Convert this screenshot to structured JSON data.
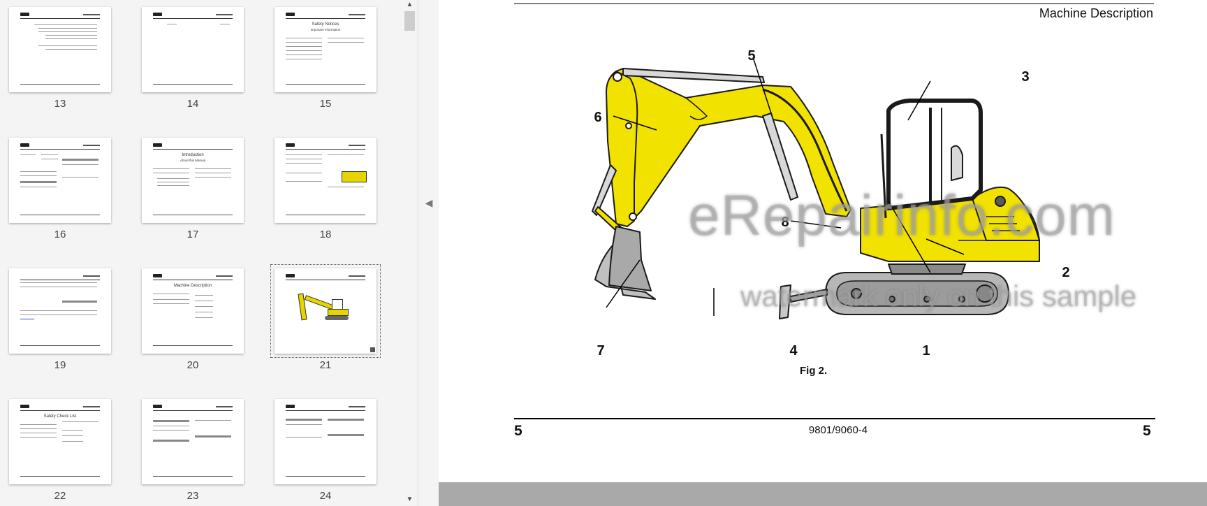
{
  "thumbnails": [
    {
      "page": "13"
    },
    {
      "page": "14"
    },
    {
      "page": "15",
      "title": "Safety Notices",
      "subtitle": "Important Information"
    },
    {
      "page": "16"
    },
    {
      "page": "17",
      "title": "Introduction",
      "subtitle": "About this Manual"
    },
    {
      "page": "18"
    },
    {
      "page": "19"
    },
    {
      "page": "20",
      "title": "Machine Description"
    },
    {
      "page": "21",
      "selected": true
    },
    {
      "page": "22",
      "title": "Safety Check List"
    },
    {
      "page": "23"
    },
    {
      "page": "24"
    }
  ],
  "page": {
    "section_title": "Machine Description",
    "figure_caption": "Fig 2.",
    "callouts": [
      "1",
      "2",
      "3",
      "4",
      "5",
      "6",
      "7",
      "8"
    ],
    "page_number_left": "5",
    "page_number_right": "5",
    "doc_code": "9801/9060-4"
  },
  "watermark": {
    "line1": "eRepairinfo.com",
    "line2": "watermark only on this sample"
  },
  "colors": {
    "machine_yellow": "#f2e200",
    "outline": "#1a1a1a",
    "bottom_bar": "#a9a9a9"
  },
  "icons": {
    "collapse": "chevron-left-icon",
    "scroll_up": "chevron-up-icon",
    "scroll_down": "chevron-down-icon"
  }
}
